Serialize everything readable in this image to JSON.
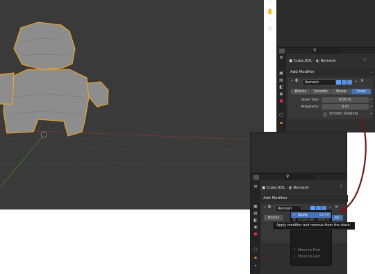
{
  "object_name": "Cube.001",
  "modifier_type_name": "Remesh",
  "add_modifier_label": "Add Modifier",
  "modifier_name_value": "Remesh",
  "modes": [
    "Blocks",
    "Smooth",
    "Sharp",
    "Voxel"
  ],
  "active_mode": "Voxel",
  "voxel_size_label": "Voxel Size",
  "voxel_size_value": "0.05 m",
  "adaptivity_label": "Adaptivity",
  "adaptivity_value": "0 m",
  "smooth_shading_label": "Smooth Shading",
  "bottom": {
    "modes_visible": [
      "Blocks"
    ],
    "active_mode_partial": "xel",
    "menu_items": [
      {
        "label": "Apply",
        "shortcut": "Ctrl A",
        "highlighted": true
      },
      {
        "label": "Duplicate",
        "shortcut": "Shift D",
        "highlighted": false
      },
      {
        "label": "Move to First",
        "shortcut": "",
        "highlighted": false
      },
      {
        "label": "Move to Last",
        "shortcut": "",
        "highlighted": false
      }
    ],
    "tooltip": "Apply modifier and remove from the stack."
  },
  "colors": {
    "viewport": "#3a3a3a",
    "panel": "#2f2f2f",
    "active_blue": "#4772b3",
    "selection_orange": "#f5a623",
    "arrow": "#6b1a1a"
  }
}
